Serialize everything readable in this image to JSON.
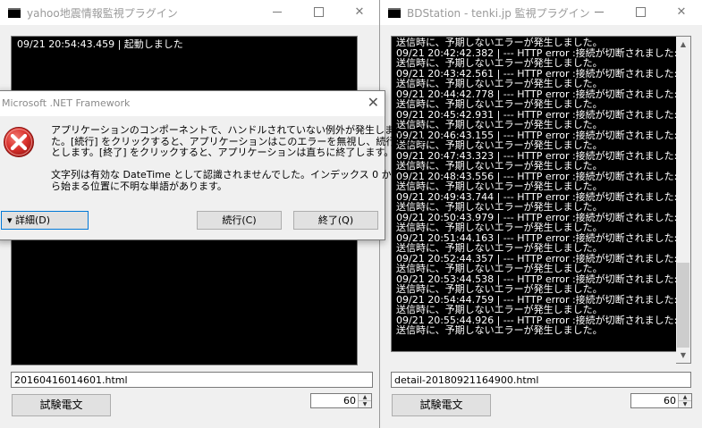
{
  "left_window": {
    "title": "yahoo地震情報監視プラグイン",
    "minimize": "—",
    "maximize": "☐",
    "close": "✕",
    "log_lines": [
      "09/21 20:54:43.459 | 起動しました"
    ],
    "filename": "20160416014601.html",
    "test_button": "試験電文",
    "interval": "60"
  },
  "right_window": {
    "title": "BDStation - tenki.jp 監視プラグイン",
    "minimize": "—",
    "maximize": "☐",
    "close": "✕",
    "log_lines": [
      "送信時に、予期しないエラーが発生しました。",
      "09/21 20:42:42.382 | --- HTTP error :接続が切断されました:",
      "送信時に、予期しないエラーが発生しました。",
      "09/21 20:43:42.561 | --- HTTP error :接続が切断されました:",
      "送信時に、予期しないエラーが発生しました。",
      "09/21 20:44:42.778 | --- HTTP error :接続が切断されました:",
      "送信時に、予期しないエラーが発生しました。",
      "09/21 20:45:42.931 | --- HTTP error :接続が切断されました:",
      "送信時に、予期しないエラーが発生しました。",
      "09/21 20:46:43.155 | --- HTTP error :接続が切断されました:",
      "送信時に、予期しないエラーが発生しました。",
      "09/21 20:47:43.323 | --- HTTP error :接続が切断されました:",
      "送信時に、予期しないエラーが発生しました。",
      "09/21 20:48:43.556 | --- HTTP error :接続が切断されました:",
      "送信時に、予期しないエラーが発生しました。",
      "09/21 20:49:43.744 | --- HTTP error :接続が切断されました:",
      "送信時に、予期しないエラーが発生しました。",
      "09/21 20:50:43.979 | --- HTTP error :接続が切断されました:",
      "送信時に、予期しないエラーが発生しました。",
      "09/21 20:51:44.163 | --- HTTP error :接続が切断されました:",
      "送信時に、予期しないエラーが発生しました。",
      "09/21 20:52:44.357 | --- HTTP error :接続が切断されました:",
      "送信時に、予期しないエラーが発生しました。",
      "09/21 20:53:44.538 | --- HTTP error :接続が切断されました:",
      "送信時に、予期しないエラーが発生しました。",
      "09/21 20:54:44.759 | --- HTTP error :接続が切断されました:",
      "送信時に、予期しないエラーが発生しました。",
      "09/21 20:55:44.926 | --- HTTP error :接続が切断されました:",
      "送信時に、予期しないエラーが発生しました。"
    ],
    "scroll_up": "▲",
    "scroll_down": "▼",
    "filename": "detail-20180921164900.html",
    "test_button": "試験電文",
    "interval": "60"
  },
  "dialog": {
    "title": "Microsoft .NET Framework",
    "close": "✕",
    "message_lines": [
      "アプリケーションのコンポーネントで、ハンドルされていない例外が発生しまし",
      "た。[続行] をクリックすると、アプリケーションはこのエラーを無視し、続行しよう",
      "とします。[終了] をクリックすると、アプリケーションは直ちに終了します。"
    ],
    "detail_lines": [
      "文字列は有効な DateTime として認識されませんでした。インデックス 0 か",
      "ら始まる位置に不明な単語があります。"
    ],
    "details_button": "▾  詳細(D)",
    "continue_button": "続行(C)",
    "quit_button": "終了(Q)"
  },
  "spinner": {
    "up": "▲",
    "down": "▼"
  },
  "colors": {
    "console_bg": "#000000",
    "console_fg": "#ffffff",
    "error_icon": "#d9302c",
    "focus_border": "#0078d7"
  }
}
